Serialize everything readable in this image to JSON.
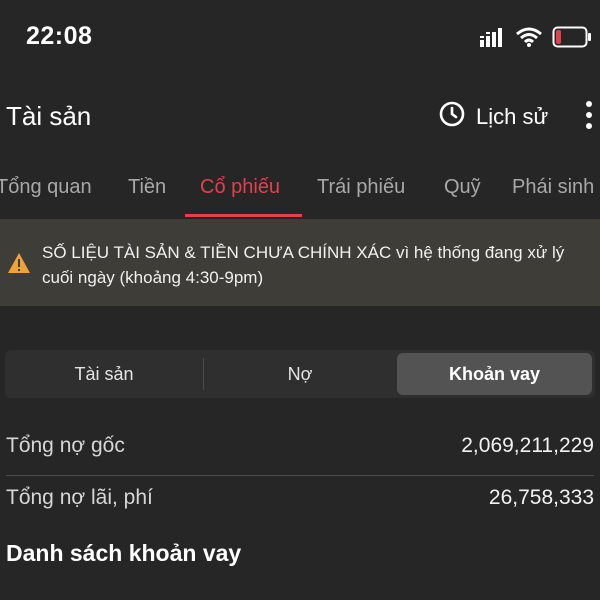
{
  "status_bar": {
    "time": "22:08",
    "icons": [
      "signal-icon",
      "wifi-icon",
      "battery-icon"
    ],
    "battery_color": "#e0424c"
  },
  "header": {
    "title": "Tài sản",
    "history_label": "Lịch sử",
    "history_icon": "clock-icon",
    "more_icon": "more-vertical-icon"
  },
  "tabs": [
    {
      "label": "Tổng quan",
      "active": false
    },
    {
      "label": "Tiền",
      "active": false
    },
    {
      "label": "Cổ phiếu",
      "active": true
    },
    {
      "label": "Trái phiếu",
      "active": false
    },
    {
      "label": "Quỹ",
      "active": false
    },
    {
      "label": "Phái sinh",
      "active": false
    }
  ],
  "warning": {
    "icon": "warning-icon",
    "text": "SỐ LIỆU TÀI SẢN & TIỀN CHƯA CHÍNH XÁC vì hệ thống đang xử lý cuối ngày (khoảng 4:30-9pm)"
  },
  "segments": [
    {
      "label": "Tài sản",
      "active": false
    },
    {
      "label": "Nợ",
      "active": false
    },
    {
      "label": "Khoản vay",
      "active": true
    }
  ],
  "summary": [
    {
      "label": "Tổng nợ gốc",
      "value": "2,069,211,229"
    },
    {
      "label": "Tổng nợ lãi, phí",
      "value": "26,758,333"
    }
  ],
  "section_title": "Danh sách khoản vay",
  "colors": {
    "accent": "#e0424c",
    "warning_icon": "#f0a33a",
    "background": "#262626",
    "warning_background": "#3e3d37"
  }
}
